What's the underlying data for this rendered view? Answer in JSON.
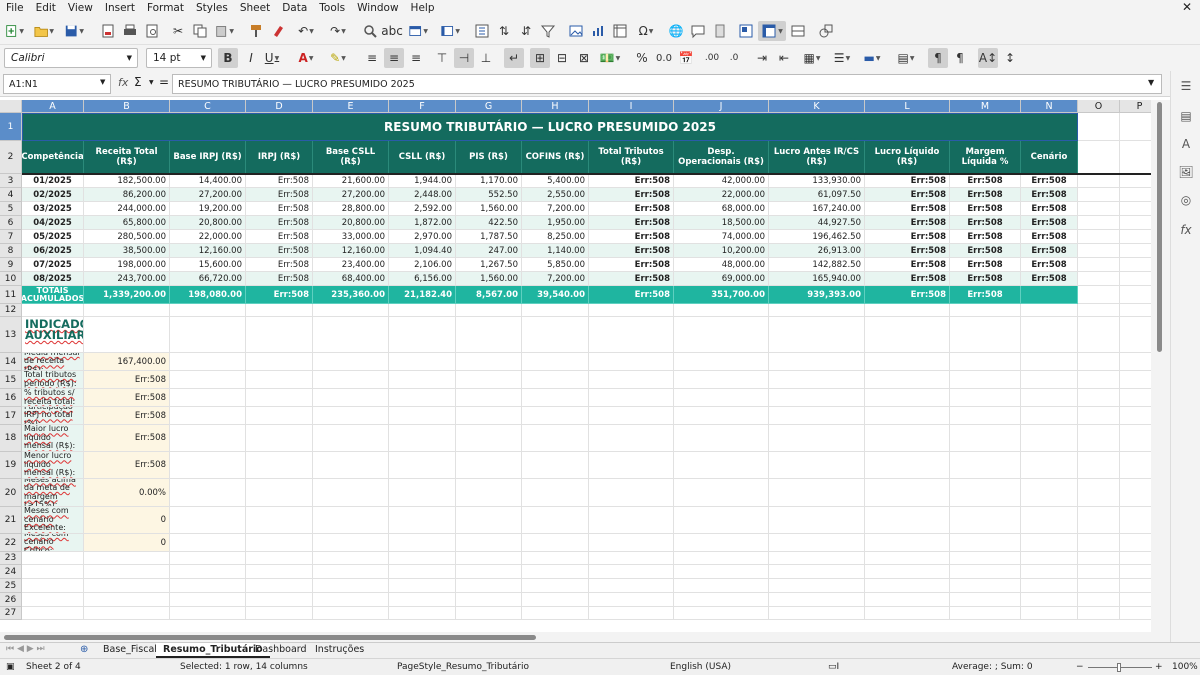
{
  "menu": [
    "File",
    "Edit",
    "View",
    "Insert",
    "Format",
    "Styles",
    "Sheet",
    "Data",
    "Tools",
    "Window",
    "Help"
  ],
  "toolbar": {
    "font_name": "Calibri",
    "font_size": "14 pt"
  },
  "formula_bar": {
    "name_box": "A1:N1",
    "fx_label": "fx",
    "sum_label": "Σ",
    "equals_label": "=",
    "content": "RESUMO TRIBUTÁRIO — LUCRO PRESUMIDO 2025"
  },
  "columns": [
    "A",
    "B",
    "C",
    "D",
    "E",
    "F",
    "G",
    "H",
    "I",
    "J",
    "K",
    "L",
    "M",
    "N",
    "O",
    "P"
  ],
  "rows": [
    "1",
    "2",
    "3",
    "4",
    "5",
    "6",
    "7",
    "8",
    "9",
    "10",
    "11",
    "12",
    "13",
    "14",
    "15",
    "16",
    "17",
    "18",
    "19",
    "20",
    "21",
    "22",
    "23",
    "24",
    "25",
    "26",
    "27"
  ],
  "sheet": {
    "title": "RESUMO TRIBUTÁRIO — LUCRO PRESUMIDO 2025",
    "headers": [
      "Competência",
      "Receita Total (R$)",
      "Base IRPJ (R$)",
      "IRPJ (R$)",
      "Base CSLL (R$)",
      "CSLL (R$)",
      "PIS (R$)",
      "COFINS (R$)",
      "Total Tributos (R$)",
      "Desp. Operacionais (R$)",
      "Lucro Antes IR/CS (R$)",
      "Lucro Líquido (R$)",
      "Margem Líquida %",
      "Cenário"
    ],
    "data_rows": [
      [
        "01/2025",
        "182,500.00",
        "14,400.00",
        "Err:508",
        "21,600.00",
        "1,944.00",
        "1,170.00",
        "5,400.00",
        "Err:508",
        "42,000.00",
        "133,930.00",
        "Err:508",
        "Err:508",
        "Err:508"
      ],
      [
        "02/2025",
        "86,200.00",
        "27,200.00",
        "Err:508",
        "27,200.00",
        "2,448.00",
        "552.50",
        "2,550.00",
        "Err:508",
        "22,000.00",
        "61,097.50",
        "Err:508",
        "Err:508",
        "Err:508"
      ],
      [
        "03/2025",
        "244,000.00",
        "19,200.00",
        "Err:508",
        "28,800.00",
        "2,592.00",
        "1,560.00",
        "7,200.00",
        "Err:508",
        "68,000.00",
        "167,240.00",
        "Err:508",
        "Err:508",
        "Err:508"
      ],
      [
        "04/2025",
        "65,800.00",
        "20,800.00",
        "Err:508",
        "20,800.00",
        "1,872.00",
        "422.50",
        "1,950.00",
        "Err:508",
        "18,500.00",
        "44,927.50",
        "Err:508",
        "Err:508",
        "Err:508"
      ],
      [
        "05/2025",
        "280,500.00",
        "22,000.00",
        "Err:508",
        "33,000.00",
        "2,970.00",
        "1,787.50",
        "8,250.00",
        "Err:508",
        "74,000.00",
        "196,462.50",
        "Err:508",
        "Err:508",
        "Err:508"
      ],
      [
        "06/2025",
        "38,500.00",
        "12,160.00",
        "Err:508",
        "12,160.00",
        "1,094.40",
        "247.00",
        "1,140.00",
        "Err:508",
        "10,200.00",
        "26,913.00",
        "Err:508",
        "Err:508",
        "Err:508"
      ],
      [
        "07/2025",
        "198,000.00",
        "15,600.00",
        "Err:508",
        "23,400.00",
        "2,106.00",
        "1,267.50",
        "5,850.00",
        "Err:508",
        "48,000.00",
        "142,882.50",
        "Err:508",
        "Err:508",
        "Err:508"
      ],
      [
        "08/2025",
        "243,700.00",
        "66,720.00",
        "Err:508",
        "68,400.00",
        "6,156.00",
        "1,560.00",
        "7,200.00",
        "Err:508",
        "69,000.00",
        "165,940.00",
        "Err:508",
        "Err:508",
        "Err:508"
      ]
    ],
    "totals": [
      "TOTAIS ACUMULADOS",
      "1,339,200.00",
      "198,080.00",
      "Err:508",
      "235,360.00",
      "21,182.40",
      "8,567.00",
      "39,540.00",
      "Err:508",
      "351,700.00",
      "939,393.00",
      "Err:508",
      "Err:508",
      ""
    ],
    "indicators_title": "INDICADORES AUXILIARES",
    "indicators": [
      {
        "label": "Média mensal de receita (R$):",
        "value": "167,400.00"
      },
      {
        "label": "Total tributos período (R$):",
        "value": "Err:508"
      },
      {
        "label": "% tributos s/ receita total:",
        "value": "Err:508"
      },
      {
        "label": "Participação IRPJ no total (%):",
        "value": "Err:508"
      },
      {
        "label": "Maior lucro líquido mensal (R$):",
        "value": "Err:508"
      },
      {
        "label": "Menor lucro líquido mensal (R$):",
        "value": "Err:508"
      },
      {
        "label": "Meses acima da meta de margem (>15%):",
        "value": "0.00%"
      },
      {
        "label": "Meses com cenário Excelente:",
        "value": "0"
      },
      {
        "label": "Meses com cenário Crítico:",
        "value": "0"
      }
    ]
  },
  "tabs": [
    "Base_Fiscal",
    "Resumo_Tributário",
    "Dashboard",
    "Instruções"
  ],
  "active_tab": "Resumo_Tributário",
  "status": {
    "sheet": "Sheet 2 of 4",
    "selection": "Selected: 1 row, 14 columns",
    "page_style": "PageStyle_Resumo_Tributário",
    "language": "English (USA)",
    "stats": "Average: ; Sum: 0",
    "zoom": "100%"
  },
  "colors": {
    "header": "#146b5e",
    "totals": "#1fb5a0",
    "band": "#e8f5f1",
    "selection": "#5b8dc9"
  }
}
